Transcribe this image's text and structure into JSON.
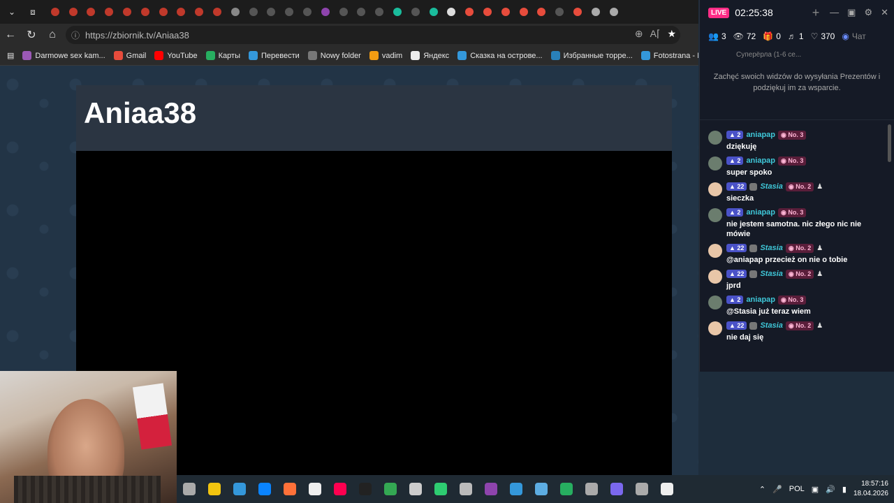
{
  "browser": {
    "url": "https://zbiornik.tv/Aniaa38",
    "tab_favicon_colors": [
      "#c0392b",
      "#c0392b",
      "#c0392b",
      "#c0392b",
      "#c0392b",
      "#c0392b",
      "#c0392b",
      "#c0392b",
      "#c0392b",
      "#c0392b",
      "#888",
      "#555",
      "#555",
      "#555",
      "#555",
      "#8e44ad",
      "#555",
      "#555",
      "#555",
      "#1abc9c",
      "#555",
      "#1abc9c",
      "#ddd",
      "#e74c3c",
      "#e74c3c",
      "#e74c3c",
      "#e74c3c",
      "#e74c3c",
      "#555",
      "#e74c3c",
      "#aaa",
      "#aaa"
    ],
    "bookmarks": [
      {
        "label": "Darmowe sex kam...",
        "color": "#9b59b6"
      },
      {
        "label": "Gmail",
        "color": "#e74c3c"
      },
      {
        "label": "YouTube",
        "color": "#ff0000"
      },
      {
        "label": "Карты",
        "color": "#27ae60"
      },
      {
        "label": "Перевести",
        "color": "#3498db"
      },
      {
        "label": "Nowy folder",
        "color": "#777"
      },
      {
        "label": "vadim",
        "color": "#f39c12"
      },
      {
        "label": "Яндекс",
        "color": "#eee"
      },
      {
        "label": "Сказка на острове...",
        "color": "#3498db"
      },
      {
        "label": "Избранные торре...",
        "color": "#2980b9"
      },
      {
        "label": "Fotostrana - No Int...",
        "color": "#3498db"
      }
    ]
  },
  "page": {
    "title": "Aniaa38"
  },
  "chat": {
    "live_badge": "LIVE",
    "timer": "02:25:38",
    "stats": {
      "users": "3",
      "viewers": "72",
      "gifts": "0",
      "followers": "1",
      "likes": "370",
      "chat_label": "Чат"
    },
    "sub_label": "Суперёрла (1-6 се...",
    "gift_note": "Zachęć swoich widzów do wysyłania Prezentów i podziękuj im za wsparcie.",
    "messages": [
      {
        "level": "2",
        "user": "aniapap",
        "rank": "No. 3",
        "text": "dziękuję",
        "avatar": "#6b7d6e",
        "italic": false,
        "people": false
      },
      {
        "level": "2",
        "user": "aniapap",
        "rank": "No. 3",
        "text": "super spoko",
        "avatar": "#6b7d6e",
        "italic": false,
        "people": false
      },
      {
        "level": "22",
        "user": "Stasia",
        "rank": "No. 2",
        "text": "sieczka",
        "avatar": "#e8c6a8",
        "italic": true,
        "people": true
      },
      {
        "level": "2",
        "user": "aniapap",
        "rank": "No. 3",
        "text": "nie jestem samotna. nic złego nic nie mówie",
        "avatar": "#6b7d6e",
        "italic": false,
        "people": false
      },
      {
        "level": "22",
        "user": "Stasia",
        "rank": "No. 2",
        "text": "@aniapap przecież on nie o tobie",
        "avatar": "#e8c6a8",
        "italic": true,
        "people": true
      },
      {
        "level": "22",
        "user": "Stasia",
        "rank": "No. 2",
        "text": "jprd",
        "avatar": "#e8c6a8",
        "italic": true,
        "people": true
      },
      {
        "level": "2",
        "user": "aniapap",
        "rank": "No. 3",
        "text": "@Stasia już teraz wiem",
        "avatar": "#6b7d6e",
        "italic": false,
        "people": false
      },
      {
        "level": "22",
        "user": "Stasia",
        "rank": "No. 2",
        "text": "nie daj się",
        "avatar": "#e8c6a8",
        "italic": true,
        "people": true
      }
    ]
  },
  "taskbar": {
    "app_colors": [
      "#aaa",
      "#f1c40f",
      "#3498db",
      "#0a84ff",
      "#ff7139",
      "#eee",
      "#ff0050",
      "#222",
      "#34a853",
      "#ccc",
      "#2ecc71",
      "#bbb",
      "#8e44ad",
      "#3498db",
      "#5dade2",
      "#27ae60",
      "#aaa",
      "#7b68ee",
      "#aaa",
      "#eee"
    ],
    "language": "POL",
    "time": "18:57:16",
    "date": "18.04.2026"
  }
}
